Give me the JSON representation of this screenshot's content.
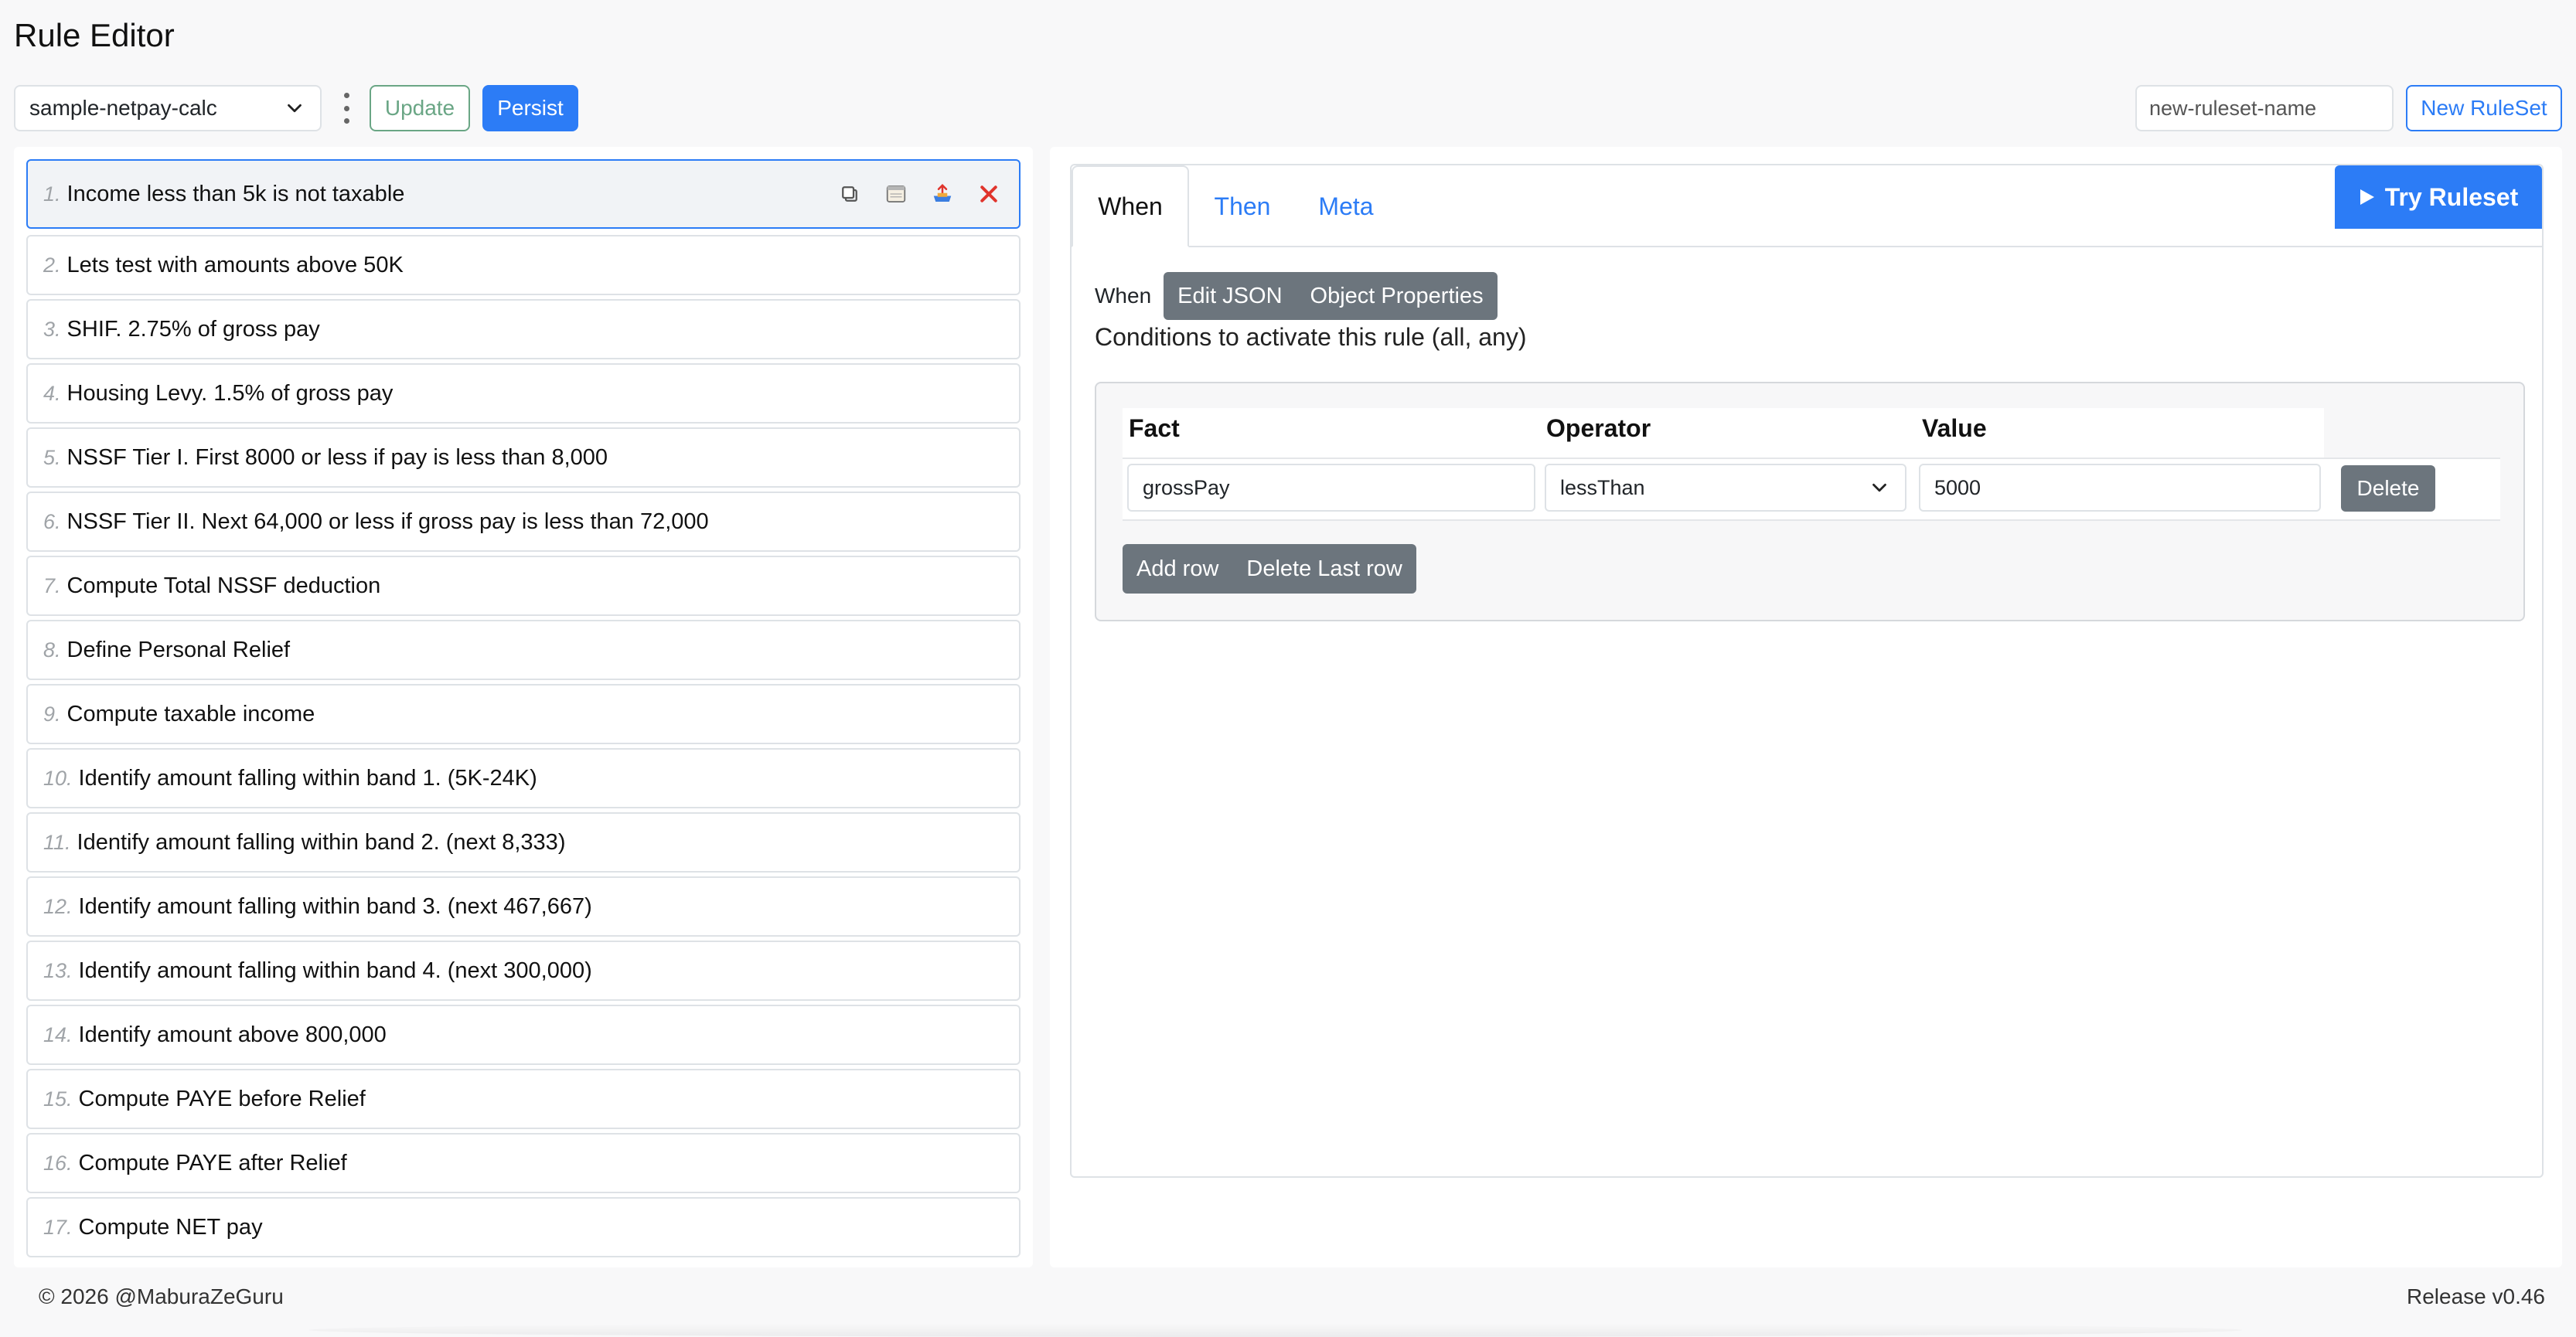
{
  "header": {
    "title": "Rule Editor"
  },
  "toolbar": {
    "ruleset_selected": "sample-netpay-calc",
    "update_label": "Update",
    "persist_label": "Persist",
    "new_ruleset_value": "new-ruleset-name",
    "new_ruleset_label": "New RuleSet"
  },
  "rules": [
    {
      "num": "1.",
      "label": "Income less than 5k is not taxable"
    },
    {
      "num": "2.",
      "label": "Lets test with amounts above 50K"
    },
    {
      "num": "3.",
      "label": "SHIF. 2.75% of gross pay"
    },
    {
      "num": "4.",
      "label": "Housing Levy. 1.5% of gross pay"
    },
    {
      "num": "5.",
      "label": "NSSF Tier I. First 8000 or less if pay is less than 8,000"
    },
    {
      "num": "6.",
      "label": "NSSF Tier II. Next 64,000 or less if gross pay is less than 72,000"
    },
    {
      "num": "7.",
      "label": "Compute Total NSSF deduction"
    },
    {
      "num": "8.",
      "label": "Define Personal Relief"
    },
    {
      "num": "9.",
      "label": "Compute taxable income"
    },
    {
      "num": "10.",
      "label": "Identify amount falling within band 1. (5K-24K)"
    },
    {
      "num": "11.",
      "label": "Identify amount falling within band 2. (next 8,333)"
    },
    {
      "num": "12.",
      "label": "Identify amount falling within band 3. (next 467,667)"
    },
    {
      "num": "13.",
      "label": "Identify amount falling within band 4. (next 300,000)"
    },
    {
      "num": "14.",
      "label": "Identify amount above 800,000"
    },
    {
      "num": "15.",
      "label": "Compute PAYE before Relief"
    },
    {
      "num": "16.",
      "label": "Compute PAYE after Relief"
    },
    {
      "num": "17.",
      "label": "Compute NET pay"
    }
  ],
  "editor": {
    "tabs": {
      "when": "When",
      "then": "Then",
      "meta": "Meta"
    },
    "try_label": "Try Ruleset",
    "when_label": "When",
    "edit_json_label": "Edit JSON",
    "object_props_label": "Object Properties",
    "description": "Conditions to activate this rule (all, any)",
    "columns": {
      "fact": "Fact",
      "operator": "Operator",
      "value": "Value"
    },
    "condition": {
      "fact": "grossPay",
      "operator": "lessThan",
      "value": "5000"
    },
    "delete_label": "Delete",
    "add_row_label": "Add row",
    "delete_last_label": "Delete Last row"
  },
  "footer": {
    "copyright": "© 2026 @MaburaZeGuru",
    "release": "Release v0.46"
  },
  "colors": {
    "accent": "#2c7cf6",
    "danger": "#e0342c",
    "secondary": "#6c757d",
    "success": "#6aa685"
  },
  "icons": [
    "chevron-down-icon",
    "kebab-icon",
    "copy-icon",
    "calendar-icon",
    "export-icon",
    "close-icon",
    "play-icon"
  ]
}
